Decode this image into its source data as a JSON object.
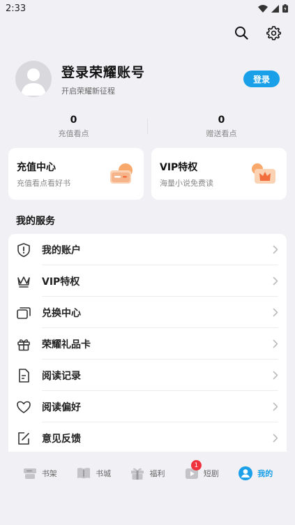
{
  "status_bar": {
    "time": "2:33"
  },
  "profile": {
    "title": "登录荣耀账号",
    "subtitle": "开启荣耀新征程",
    "login_label": "登录"
  },
  "stats": [
    {
      "value": "0",
      "label": "充值看点"
    },
    {
      "value": "0",
      "label": "赠送看点"
    }
  ],
  "cards": [
    {
      "title": "充值中心",
      "subtitle": "充值看点看好书"
    },
    {
      "title": "VIP特权",
      "subtitle": "海量小说免费读"
    }
  ],
  "services": {
    "title": "我的服务",
    "items": [
      {
        "label": "我的账户",
        "icon": "shield-icon"
      },
      {
        "label": "VIP特权",
        "icon": "crown-icon"
      },
      {
        "label": "兑换中心",
        "icon": "cards-icon"
      },
      {
        "label": "荣耀礼品卡",
        "icon": "gift-icon"
      },
      {
        "label": "阅读记录",
        "icon": "document-icon"
      },
      {
        "label": "阅读偏好",
        "icon": "heart-icon"
      },
      {
        "label": "意见反馈",
        "icon": "edit-icon"
      }
    ]
  },
  "bottom_nav": {
    "items": [
      {
        "label": "书架",
        "icon": "bookshelf-icon"
      },
      {
        "label": "书城",
        "icon": "book-icon"
      },
      {
        "label": "福利",
        "icon": "gift-box-icon"
      },
      {
        "label": "短剧",
        "icon": "video-icon",
        "badge": "1"
      },
      {
        "label": "我的",
        "icon": "profile-icon",
        "active": true
      }
    ]
  },
  "colors": {
    "accent": "#1aa0e8",
    "badge": "#f0323c",
    "background": "#f1f1f5"
  }
}
